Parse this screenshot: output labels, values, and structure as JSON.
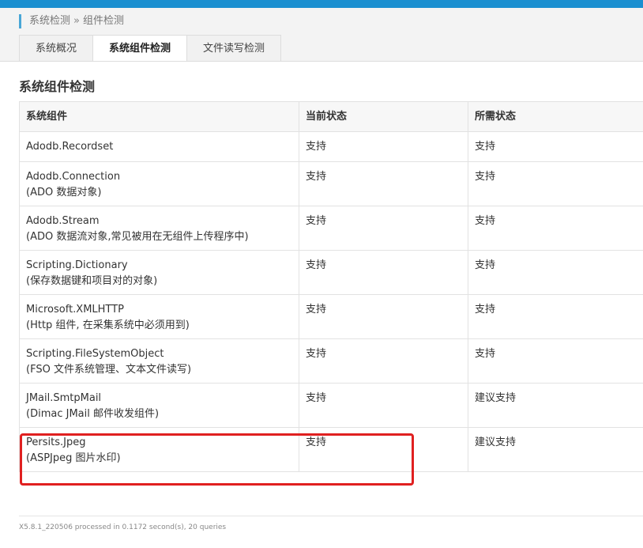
{
  "breadcrumb": {
    "root": "系统检测",
    "sep": "»",
    "current": "组件检测"
  },
  "tabs": [
    {
      "label": "系统概况"
    },
    {
      "label": "系统组件检测"
    },
    {
      "label": "文件读写检测"
    }
  ],
  "section_title": "系统组件检测",
  "table": {
    "headers": [
      "系统组件",
      "当前状态",
      "所需状态"
    ],
    "rows": [
      {
        "name": "Adodb.Recordset",
        "desc": "",
        "current": "支持",
        "required": "支持"
      },
      {
        "name": "Adodb.Connection",
        "desc": "(ADO 数据对象)",
        "current": "支持",
        "required": "支持"
      },
      {
        "name": "Adodb.Stream",
        "desc": "(ADO 数据流对象,常见被用在无组件上传程序中)",
        "current": "支持",
        "required": "支持"
      },
      {
        "name": "Scripting.Dictionary",
        "desc": "(保存数据键和项目对的对象)",
        "current": "支持",
        "required": "支持"
      },
      {
        "name": "Microsoft.XMLHTTP",
        "desc": "(Http 组件, 在采集系统中必须用到)",
        "current": "支持",
        "required": "支持"
      },
      {
        "name": "Scripting.FileSystemObject",
        "desc": "(FSO 文件系统管理、文本文件读写)",
        "current": "支持",
        "required": "支持"
      },
      {
        "name": "JMail.SmtpMail",
        "desc": "(Dimac JMail 邮件收发组件)",
        "current": "支持",
        "required": "建议支持"
      },
      {
        "name": "Persits.Jpeg",
        "desc": "(ASPJpeg 图片水印)",
        "current": "支持",
        "required": "建议支持"
      }
    ]
  },
  "footer": "X5.8.1_220506 processed in 0.1172 second(s), 20 queries",
  "colors": {
    "topbar": "#1a8fd0",
    "highlight": "#e02020",
    "breadcrumb_bar": "#48a6d7"
  }
}
